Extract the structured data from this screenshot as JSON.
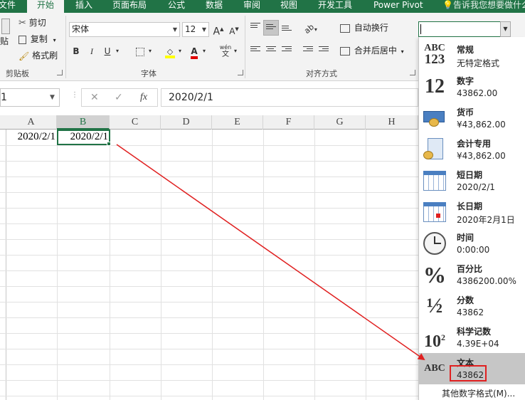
{
  "tabs": [
    {
      "label": "文件",
      "active": false
    },
    {
      "label": "开始",
      "active": true
    },
    {
      "label": "插入",
      "active": false
    },
    {
      "label": "页面布局",
      "active": false
    },
    {
      "label": "公式",
      "active": false
    },
    {
      "label": "数据",
      "active": false
    },
    {
      "label": "审阅",
      "active": false
    },
    {
      "label": "视图",
      "active": false
    },
    {
      "label": "开发工具",
      "active": false
    },
    {
      "label": "Power Pivot",
      "active": false
    }
  ],
  "tell_me": "告诉我您想要做什么",
  "clipboard": {
    "paste_label": "贴",
    "cut_label": "剪切",
    "copy_label": "复制",
    "format_painter_label": "格式刷",
    "group_label": "剪贴板"
  },
  "font": {
    "name": "宋体",
    "size": "12",
    "bold": "B",
    "italic": "I",
    "underline": "U",
    "grow": "A",
    "shrink": "A",
    "color_a": "A",
    "phonetic": "wén",
    "group_label": "字体"
  },
  "alignment": {
    "wrap_label": "自动换行",
    "merge_label": "合并后居中",
    "group_label": "对齐方式"
  },
  "formula_bar": {
    "name_box": "1",
    "cancel": "✕",
    "enter": "✓",
    "fx": "fx",
    "value": "2020/2/1"
  },
  "columns": [
    "A",
    "B",
    "C",
    "D",
    "E",
    "F",
    "G",
    "H"
  ],
  "cells": {
    "A1": "2020/2/1",
    "B1": "2020/2/1"
  },
  "number_format": {
    "current": "",
    "items": [
      {
        "name": "常规",
        "example": "无特定格式",
        "icon": "abc-123-icon"
      },
      {
        "name": "数字",
        "example": "43862.00",
        "icon": "number-12-icon"
      },
      {
        "name": "货币",
        "example": "¥43,862.00",
        "icon": "currency-icon"
      },
      {
        "name": "会计专用",
        "example": " ¥43,862.00",
        "icon": "accounting-icon"
      },
      {
        "name": "短日期",
        "example": "2020/2/1",
        "icon": "short-date-calendar-icon"
      },
      {
        "name": "长日期",
        "example": "2020年2月1日",
        "icon": "long-date-calendar-icon"
      },
      {
        "name": "时间",
        "example": "0:00:00",
        "icon": "clock-icon"
      },
      {
        "name": "百分比",
        "example": "4386200.00%",
        "icon": "percent-icon"
      },
      {
        "name": "分数",
        "example": "43862",
        "icon": "fraction-icon"
      },
      {
        "name": "科学记数",
        "example": "4.39E+04",
        "icon": "scientific-icon"
      },
      {
        "name": "文本",
        "example": "43862",
        "icon": "abc-text-icon",
        "highlighted": true
      }
    ],
    "more_label": "其他数字格式(M)..."
  },
  "colors": {
    "brand": "#217346",
    "annotation": "#e02020",
    "highlight": "#c6c6c6"
  }
}
